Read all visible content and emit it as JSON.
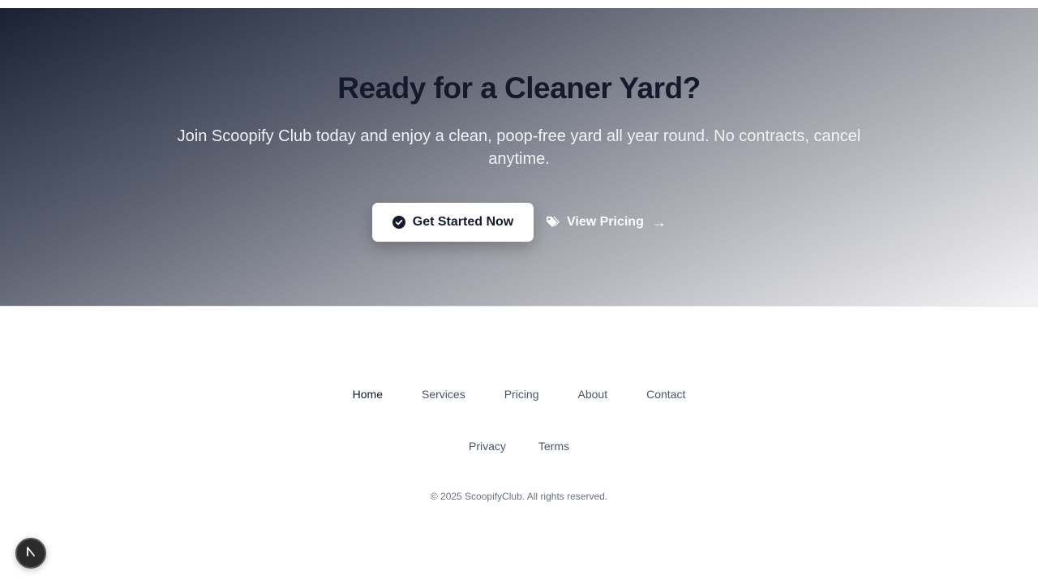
{
  "cta": {
    "title": "Ready for a Cleaner Yard?",
    "subtitle": "Join Scoopify Club today and enjoy a clean, poop-free yard all year round. No contracts, cancel anytime.",
    "primary_button": {
      "label": "Get Started Now",
      "icon": "check-circle-icon"
    },
    "secondary_link": {
      "label": "View Pricing",
      "icon": "tags-icon",
      "arrow": "→"
    }
  },
  "footer": {
    "nav": [
      {
        "label": "Home",
        "active": true
      },
      {
        "label": "Services",
        "active": false
      },
      {
        "label": "Pricing",
        "active": false
      },
      {
        "label": "About",
        "active": false
      },
      {
        "label": "Contact",
        "active": false
      }
    ],
    "legal": [
      {
        "label": "Privacy"
      },
      {
        "label": "Terms"
      }
    ],
    "copyright": "© 2025 ScoopifyClub. All rights reserved."
  },
  "floating_button": {
    "icon": "dev-tools-icon"
  },
  "colors": {
    "text_dark": "#141a2b",
    "text_muted": "#4b5563",
    "gradient_start": "#1a2133",
    "gradient_end": "#f4f4f6"
  }
}
